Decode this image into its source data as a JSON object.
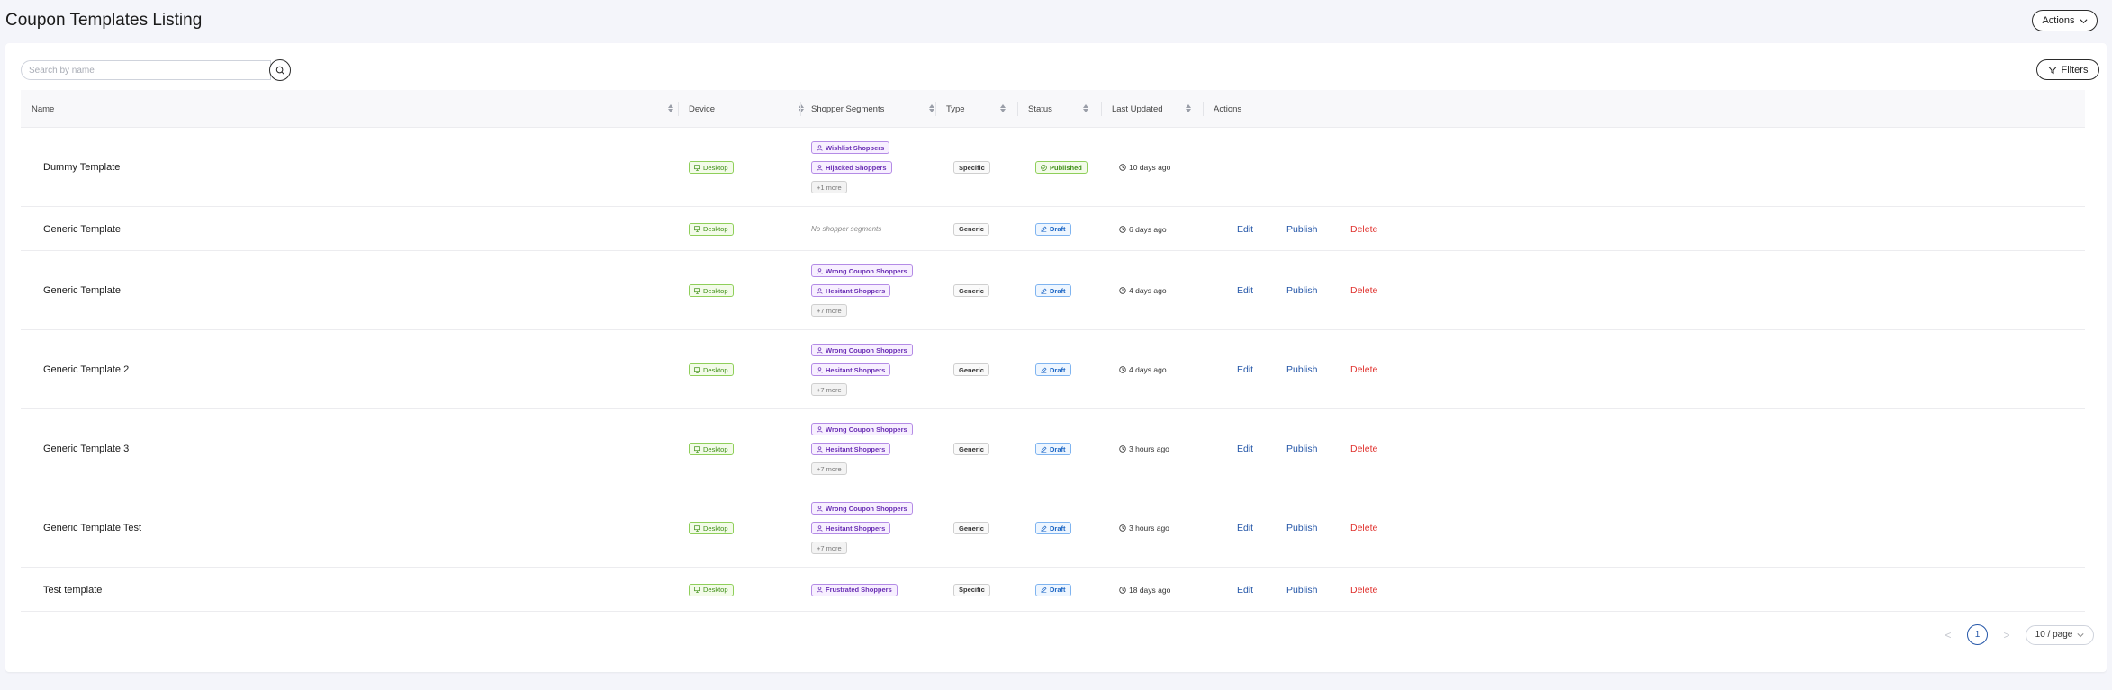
{
  "page": {
    "title": "Coupon Templates Listing",
    "actions_label": "Actions"
  },
  "toolbar": {
    "search_placeholder": "Search by name",
    "filters_label": "Filters"
  },
  "columns": [
    "Name",
    "Device",
    "Shopper Segments",
    "Type",
    "Status",
    "Last Updated",
    "Actions"
  ],
  "rows": [
    {
      "name": "Dummy Template",
      "device": "Desktop",
      "segments": [
        "Wishlist Shoppers",
        "Hijacked Shoppers"
      ],
      "more": "+1 more",
      "type": "Specific",
      "status": "Published",
      "updated": "10 days ago",
      "actions": false
    },
    {
      "name": "Generic Template",
      "device": "Desktop",
      "segments": [],
      "no_segments": "No shopper segments",
      "more": "",
      "type": "Generic",
      "status": "Draft",
      "updated": "6 days ago",
      "actions": true
    },
    {
      "name": "Generic Template",
      "device": "Desktop",
      "segments": [
        "Wrong Coupon Shoppers",
        "Hesitant Shoppers"
      ],
      "more": "+7 more",
      "type": "Generic",
      "status": "Draft",
      "updated": "4 days ago",
      "actions": true
    },
    {
      "name": "Generic Template 2",
      "device": "Desktop",
      "segments": [
        "Wrong Coupon Shoppers",
        "Hesitant Shoppers"
      ],
      "more": "+7 more",
      "type": "Generic",
      "status": "Draft",
      "updated": "4 days ago",
      "actions": true
    },
    {
      "name": "Generic Template 3",
      "device": "Desktop",
      "segments": [
        "Wrong Coupon Shoppers",
        "Hesitant Shoppers"
      ],
      "more": "+7 more",
      "type": "Generic",
      "status": "Draft",
      "updated": "3 hours ago",
      "actions": true
    },
    {
      "name": "Generic Template Test",
      "device": "Desktop",
      "segments": [
        "Wrong Coupon Shoppers",
        "Hesitant Shoppers"
      ],
      "more": "+7 more",
      "type": "Generic",
      "status": "Draft",
      "updated": "3 hours ago",
      "actions": true
    },
    {
      "name": "Test template",
      "device": "Desktop",
      "segments": [
        "Frustrated Shoppers"
      ],
      "more": "",
      "type": "Specific",
      "status": "Draft",
      "updated": "18 days ago",
      "actions": true
    }
  ],
  "row_actions": {
    "edit": "Edit",
    "publish": "Publish",
    "delete": "Delete"
  },
  "pagination": {
    "current_page": "1",
    "page_size": "10 / page",
    "prev": "<",
    "next": ">"
  },
  "colors": {
    "link": "#2456a8",
    "danger": "#e0332f",
    "segment": "#6a2fb4",
    "device": "#3e8f16"
  }
}
